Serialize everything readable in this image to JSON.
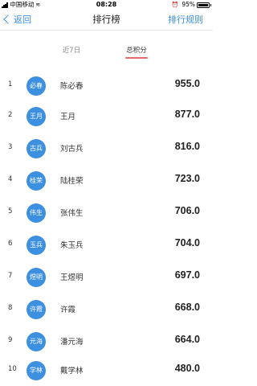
{
  "statusbar": {
    "carrier": "中国移动",
    "time": "08:28",
    "battery": "95%"
  },
  "navbar": {
    "back_label": "返回",
    "title": "排行榜",
    "action_label": "排行规则"
  },
  "tabs": [
    {
      "label": "近7日",
      "active": false
    },
    {
      "label": "总积分",
      "active": true
    }
  ],
  "ranking": [
    {
      "rank": "1",
      "avatar": "必春",
      "name": "陈必春",
      "score": "955.0"
    },
    {
      "rank": "2",
      "avatar": "王月",
      "name": "王月",
      "score": "877.0"
    },
    {
      "rank": "3",
      "avatar": "古兵",
      "name": "刘古兵",
      "score": "816.0"
    },
    {
      "rank": "4",
      "avatar": "桂荣",
      "name": "陆桂荣",
      "score": "723.0"
    },
    {
      "rank": "5",
      "avatar": "伟生",
      "name": "张伟生",
      "score": "706.0"
    },
    {
      "rank": "6",
      "avatar": "玉兵",
      "name": "朱玉兵",
      "score": "704.0"
    },
    {
      "rank": "7",
      "avatar": "煜明",
      "name": "王煜明",
      "score": "697.0"
    },
    {
      "rank": "8",
      "avatar": "许霞",
      "name": "许霞",
      "score": "668.0"
    },
    {
      "rank": "9",
      "avatar": "元海",
      "name": "潘元海",
      "score": "664.0"
    },
    {
      "rank": "10",
      "avatar": "学林",
      "name": "戴学林",
      "score": "480.0"
    }
  ],
  "colors": {
    "accent": "#3a8ee6",
    "avatar_bg": "#3d8fe0",
    "tab_underline": "#e36a6a"
  }
}
